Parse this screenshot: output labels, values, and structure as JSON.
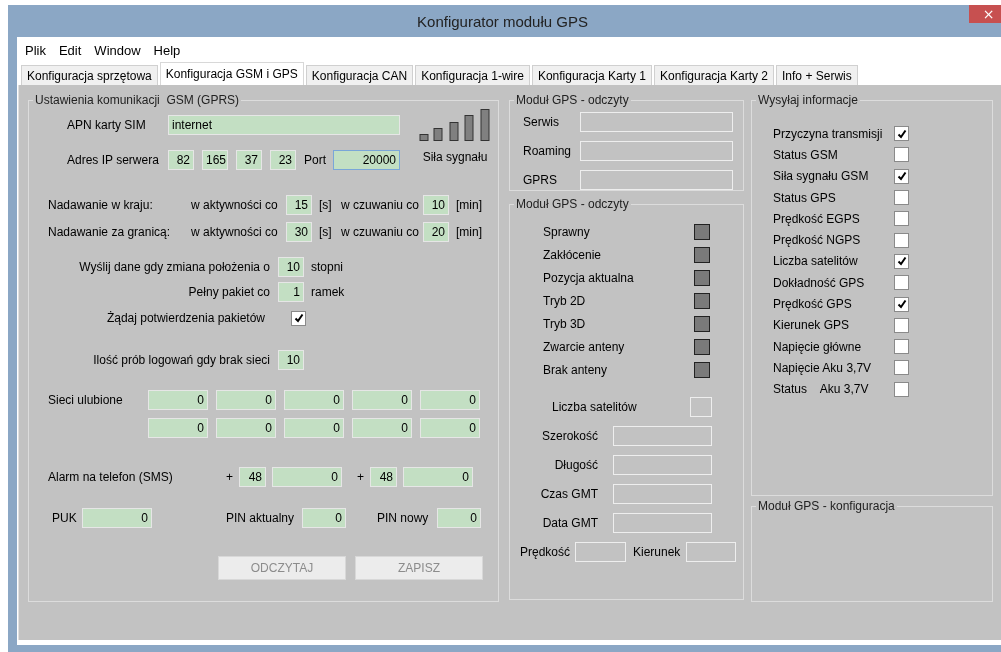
{
  "window": {
    "title": "Konfigurator modułu GPS",
    "close": "×"
  },
  "menu": [
    "Plik",
    "Edit",
    "Window",
    "Help"
  ],
  "tabs": [
    {
      "label": "Konfiguracja sprzętowa",
      "selected": false
    },
    {
      "label": "Konfiguracja GSM i GPS",
      "selected": true
    },
    {
      "label": "Konfiguracja CAN",
      "selected": false
    },
    {
      "label": "Konfiguracja 1-wire",
      "selected": false
    },
    {
      "label": "Konfiguracja Karty 1",
      "selected": false
    },
    {
      "label": "Konfiguracja Karty 2",
      "selected": false
    },
    {
      "label": "Info + Serwis",
      "selected": false
    }
  ],
  "gsm": {
    "title": "Ustawienia komunikacji  GSM (GPRS)",
    "apn": {
      "label": "APN karty SIM",
      "value": "internet"
    },
    "ip": {
      "label": "Adres IP serwera",
      "octets": [
        "82",
        "165",
        "37",
        "23"
      ],
      "port_label": "Port",
      "port_value": "20000"
    },
    "signal": {
      "label": "Siła sygnału"
    },
    "broadcast": [
      {
        "label": "Nadawanie w kraju:",
        "active_label": "w aktywności co",
        "active_value": "15",
        "active_unit": "[s]",
        "standby_label": "w czuwaniu co",
        "standby_value": "10",
        "standby_unit": "[min]"
      },
      {
        "label": "Nadawanie za granicą:",
        "active_label": "w aktywności co",
        "active_value": "30",
        "active_unit": "[s]",
        "standby_label": "w czuwaniu co",
        "standby_value": "20",
        "standby_unit": "[min]"
      }
    ],
    "position_change": {
      "label": "Wyślij dane gdy zmiana położenia o",
      "value": "10",
      "unit": "stopni"
    },
    "full_packet": {
      "label": "Pełny pakiet co",
      "value": "1",
      "unit": "ramek"
    },
    "confirm": {
      "label": "Żądaj potwierdzenia pakietów",
      "checked": true
    },
    "login_attempts": {
      "label": "Ilość prób logowań gdy brak sieci",
      "value": "10"
    },
    "favourite_networks": {
      "label": "Sieci ulubione",
      "rows": [
        [
          "0",
          "0",
          "0",
          "0",
          "0"
        ],
        [
          "0",
          "0",
          "0",
          "0",
          "0"
        ]
      ]
    },
    "alarm": {
      "label": "Alarm na telefon (SMS)",
      "numbers": [
        {
          "plus": "+",
          "prefix": "48",
          "value": "0"
        },
        {
          "plus": "+",
          "prefix": "48",
          "value": "0"
        }
      ]
    },
    "puk": {
      "label": "PUK",
      "value": "0"
    },
    "pin_current": {
      "label": "PIN aktualny",
      "value": "0"
    },
    "pin_new": {
      "label": "PIN nowy",
      "value": "0"
    },
    "buttons": [
      {
        "label": "ODCZYTAJ",
        "disabled": true
      },
      {
        "label": "ZAPISZ",
        "disabled": true
      }
    ]
  },
  "gps_status": {
    "title": "Moduł GPS - odczyty",
    "fields": [
      {
        "label": "Serwis"
      },
      {
        "label": "Roaming"
      },
      {
        "label": "GPRS"
      }
    ]
  },
  "gps_readings": {
    "title": "Moduł GPS - odczyty",
    "indicators": [
      {
        "label": "Sprawny",
        "on": false
      },
      {
        "label": "Zakłócenie",
        "on": false
      },
      {
        "label": "Pozycja aktualna",
        "on": false
      },
      {
        "label": "Tryb 2D",
        "on": false
      },
      {
        "label": "Tryb 3D",
        "on": false
      },
      {
        "label": "Zwarcie anteny",
        "on": false
      },
      {
        "label": "Brak anteny",
        "on": false
      }
    ],
    "satellites_label": "Liczba satelitów",
    "fields": [
      {
        "label": "Szerokość"
      },
      {
        "label": "Długość"
      },
      {
        "label": "Czas GMT"
      },
      {
        "label": "Data GMT"
      }
    ],
    "speed_label": "Prędkość",
    "direction_label": "Kierunek"
  },
  "send_info": {
    "title": "Wysyłaj informacje",
    "items": [
      {
        "label": "Przyczyna transmisji",
        "checked": true
      },
      {
        "label": "Status GSM",
        "checked": false
      },
      {
        "label": "Siła sygnału GSM",
        "checked": true
      },
      {
        "label": "Status GPS",
        "checked": false
      },
      {
        "label": "Prędkość EGPS",
        "checked": false
      },
      {
        "label": "Prędkość NGPS",
        "checked": false
      },
      {
        "label": "Liczba satelitów",
        "checked": true
      },
      {
        "label": "Dokładność GPS",
        "checked": false
      },
      {
        "label": "Prędkość GPS",
        "checked": true
      },
      {
        "label": "Kierunek GPS",
        "checked": false
      },
      {
        "label": "Napięcie główne",
        "checked": false
      },
      {
        "label": "Napięcie Aku 3,7V",
        "checked": false
      },
      {
        "label": "Status    Aku 3,7V",
        "checked": false
      }
    ]
  },
  "gps_config": {
    "title": "Moduł GPS - konfiguracja"
  }
}
